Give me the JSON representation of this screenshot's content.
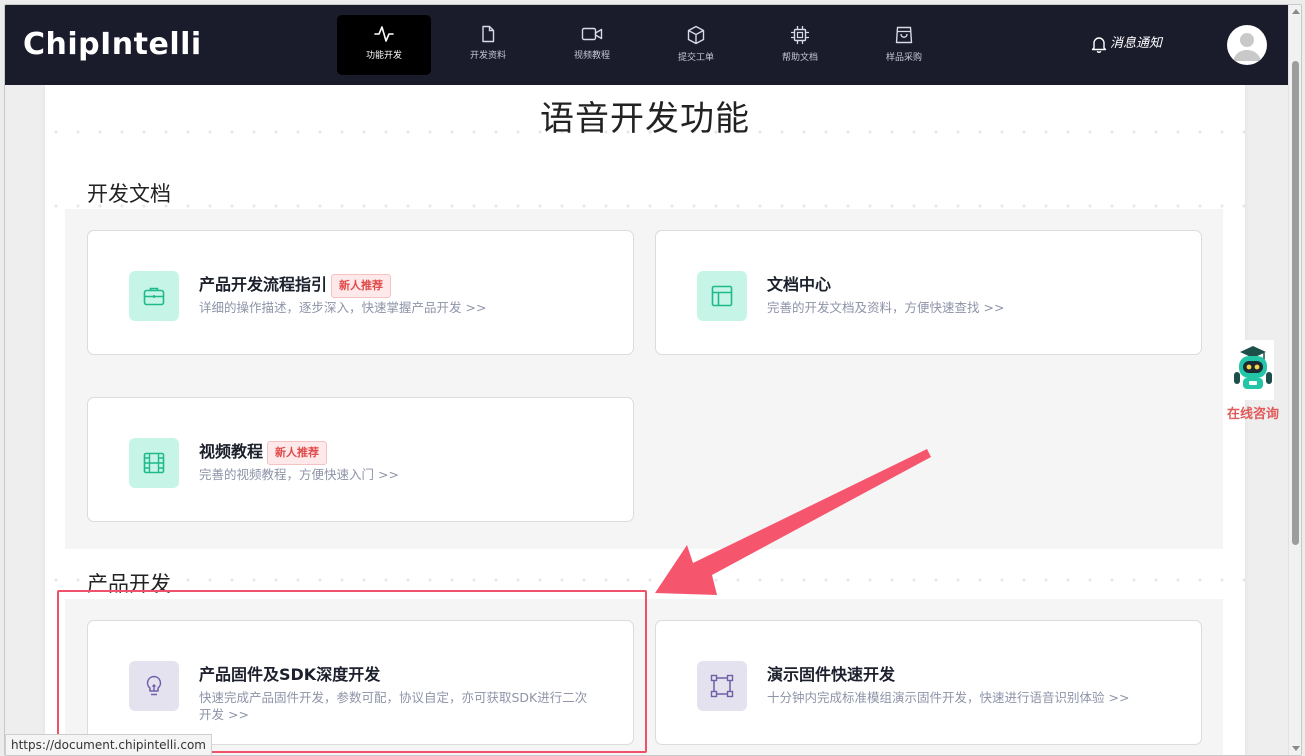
{
  "header": {
    "logo": "ChipIntelli",
    "nav": [
      {
        "label": "功能开发",
        "icon": "activity-icon",
        "active": true
      },
      {
        "label": "开发资料",
        "icon": "file-icon",
        "active": false
      },
      {
        "label": "视频教程",
        "icon": "video-icon",
        "active": false
      },
      {
        "label": "提交工单",
        "icon": "box-icon",
        "active": false
      },
      {
        "label": "帮助文档",
        "icon": "chip-icon",
        "active": false
      },
      {
        "label": "样品采购",
        "icon": "shopping-bag-icon",
        "active": false
      }
    ],
    "notice": "消息通知"
  },
  "page": {
    "title": "语音开发功能"
  },
  "sections": {
    "docs": {
      "title": "开发文档",
      "cards": [
        {
          "title": "产品开发流程指引",
          "badge": "新人推荐",
          "desc": "详细的操作描述，逐步深入，快速掌握产品开发 >>",
          "icon": "briefcase-icon"
        },
        {
          "title": "文档中心",
          "desc": "完善的开发文档及资料，方便快速查找 >>",
          "icon": "layout-icon"
        },
        {
          "title": "视频教程",
          "badge": "新人推荐",
          "desc": "完善的视频教程，方便快速入门 >>",
          "icon": "film-icon"
        }
      ]
    },
    "product": {
      "title": "产品开发",
      "cards": [
        {
          "title": "产品固件及SDK深度开发",
          "desc": "快速完成产品固件开发，参数可配，协议自定，亦可获取SDK进行二次开发 >>",
          "icon": "lightbulb-icon"
        },
        {
          "title": "演示固件快速开发",
          "desc": "十分钟内完成标准模组演示固件开发，快速进行语音识别体验 >>",
          "icon": "frame-icon"
        }
      ]
    }
  },
  "consult": {
    "label": "在线咨询"
  },
  "statusbar": {
    "url": "https://document.chipintelli.com"
  },
  "colors": {
    "header_bg": "#1a1b2b",
    "icon_green_bg": "#c6f5e8",
    "icon_green": "#1fb98a",
    "icon_purple_bg": "#e5e2ef",
    "icon_purple": "#6e5fa8",
    "badge_red": "#e24b4b",
    "annotation": "#f0506a"
  }
}
